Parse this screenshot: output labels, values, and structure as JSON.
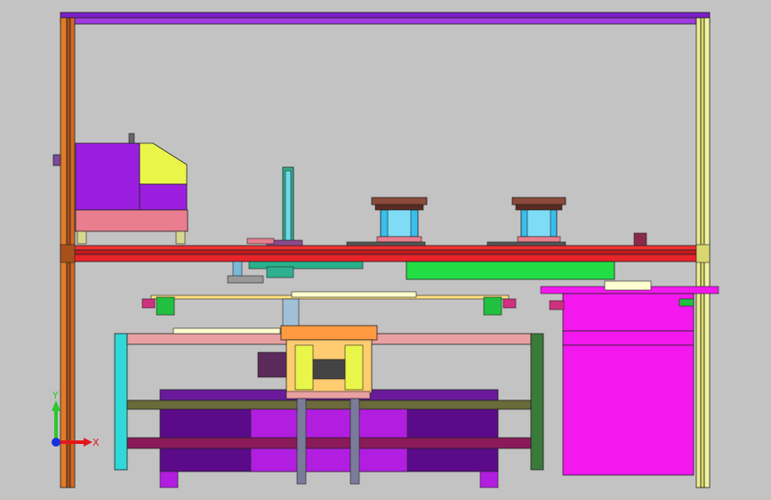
{
  "viewport": {
    "background": "#c3c3c3",
    "triad": {
      "x_label": "X",
      "y_label": "Y",
      "z_label": ""
    }
  },
  "colors": {
    "frame_orange": "#c8641e",
    "frame_yellow": "#eeee90",
    "frame_purple": "#7a1fc9",
    "plate_red": "#e8232a",
    "cabinet_purple": "#9b1ee0",
    "cabinet_pink": "#e87e8e",
    "cabinet_yellow": "#eaf54a",
    "magenta": "#f218ee",
    "green_block": "#22dd44",
    "table_cyan": "#30d8d8",
    "table_darkgreen": "#3a7a3a",
    "cylinder_blue": "#38bfee",
    "dark_purple": "#5b0b8a",
    "axis_x": "#e4181c",
    "axis_y": "#2cc82c",
    "axis_z": "#1830e0"
  }
}
